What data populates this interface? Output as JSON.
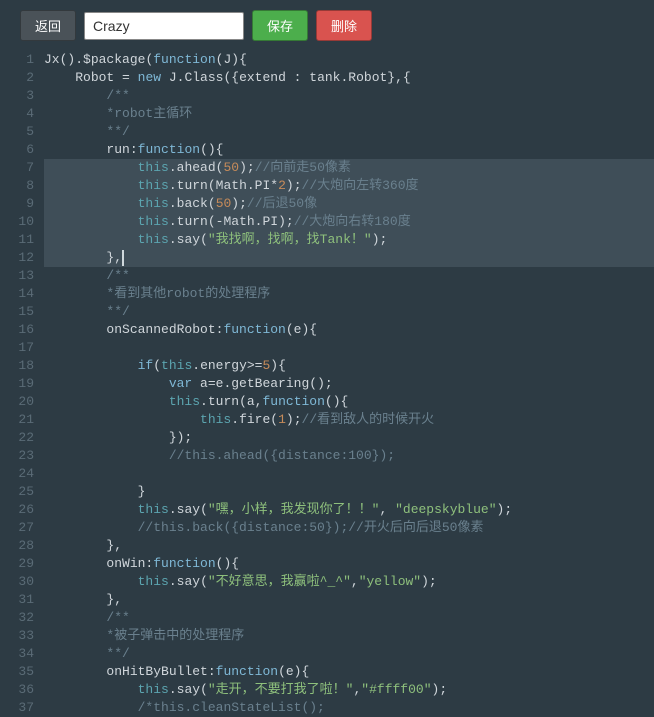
{
  "toolbar": {
    "back_label": "返回",
    "name_value": "Crazy",
    "save_label": "保存",
    "delete_label": "删除"
  },
  "editor": {
    "highlight_start": 7,
    "highlight_end": 12,
    "cursor_line": 12,
    "lines": [
      {
        "n": 1,
        "tokens": [
          [
            "p",
            "Jx()."
          ],
          [
            "p",
            "$package"
          ],
          [
            "p",
            "("
          ],
          [
            "k",
            "function"
          ],
          [
            "p",
            "(J){"
          ]
        ]
      },
      {
        "n": 2,
        "indent": 4,
        "tokens": [
          [
            "p",
            "Robot = "
          ],
          [
            "k",
            "new"
          ],
          [
            "p",
            " J."
          ],
          [
            "fn",
            "Class"
          ],
          [
            "p",
            "({extend : tank.Robot},{"
          ]
        ]
      },
      {
        "n": 3,
        "indent": 8,
        "tokens": [
          [
            "c",
            "/**"
          ]
        ]
      },
      {
        "n": 4,
        "indent": 8,
        "tokens": [
          [
            "c",
            "*robot主循环"
          ]
        ]
      },
      {
        "n": 5,
        "indent": 8,
        "tokens": [
          [
            "c",
            "**/"
          ]
        ]
      },
      {
        "n": 6,
        "indent": 8,
        "tokens": [
          [
            "p",
            "run:"
          ],
          [
            "k",
            "function"
          ],
          [
            "p",
            "(){"
          ]
        ]
      },
      {
        "n": 7,
        "indent": 12,
        "tokens": [
          [
            "b",
            "this"
          ],
          [
            "p",
            "."
          ],
          [
            "fn",
            "ahead"
          ],
          [
            "p",
            "("
          ],
          [
            "n",
            "50"
          ],
          [
            "p",
            ");"
          ],
          [
            "c",
            "//向前走50像素"
          ]
        ]
      },
      {
        "n": 8,
        "indent": 12,
        "tokens": [
          [
            "b",
            "this"
          ],
          [
            "p",
            "."
          ],
          [
            "fn",
            "turn"
          ],
          [
            "p",
            "(Math.PI*"
          ],
          [
            "n",
            "2"
          ],
          [
            "p",
            ");"
          ],
          [
            "c",
            "//大炮向左转360度"
          ]
        ]
      },
      {
        "n": 9,
        "indent": 12,
        "tokens": [
          [
            "b",
            "this"
          ],
          [
            "p",
            "."
          ],
          [
            "fn",
            "back"
          ],
          [
            "p",
            "("
          ],
          [
            "n",
            "50"
          ],
          [
            "p",
            ");"
          ],
          [
            "c",
            "//后退50像"
          ]
        ]
      },
      {
        "n": 10,
        "indent": 12,
        "tokens": [
          [
            "b",
            "this"
          ],
          [
            "p",
            "."
          ],
          [
            "fn",
            "turn"
          ],
          [
            "p",
            "(-Math.PI);"
          ],
          [
            "c",
            "//大炮向右转180度"
          ]
        ]
      },
      {
        "n": 11,
        "indent": 12,
        "tokens": [
          [
            "b",
            "this"
          ],
          [
            "p",
            "."
          ],
          [
            "fn",
            "say"
          ],
          [
            "p",
            "("
          ],
          [
            "s",
            "\"我找啊，找啊，找Tank！\""
          ],
          [
            "p",
            ");"
          ]
        ]
      },
      {
        "n": 12,
        "indent": 8,
        "tokens": [
          [
            "p",
            "},"
          ]
        ]
      },
      {
        "n": 13,
        "indent": 8,
        "tokens": [
          [
            "c",
            "/**"
          ]
        ]
      },
      {
        "n": 14,
        "indent": 8,
        "tokens": [
          [
            "c",
            "*看到其他robot的处理程序"
          ]
        ]
      },
      {
        "n": 15,
        "indent": 8,
        "tokens": [
          [
            "c",
            "**/"
          ]
        ]
      },
      {
        "n": 16,
        "indent": 8,
        "tokens": [
          [
            "p",
            "onScannedRobot:"
          ],
          [
            "k",
            "function"
          ],
          [
            "p",
            "(e){"
          ]
        ]
      },
      {
        "n": 17,
        "indent": 0,
        "tokens": []
      },
      {
        "n": 18,
        "indent": 12,
        "tokens": [
          [
            "k",
            "if"
          ],
          [
            "p",
            "("
          ],
          [
            "b",
            "this"
          ],
          [
            "p",
            ".energy>="
          ],
          [
            "n",
            "5"
          ],
          [
            "p",
            "){"
          ]
        ]
      },
      {
        "n": 19,
        "indent": 16,
        "tokens": [
          [
            "k",
            "var"
          ],
          [
            "p",
            " a=e."
          ],
          [
            "fn",
            "getBearing"
          ],
          [
            "p",
            "();"
          ]
        ]
      },
      {
        "n": 20,
        "indent": 16,
        "tokens": [
          [
            "b",
            "this"
          ],
          [
            "p",
            "."
          ],
          [
            "fn",
            "turn"
          ],
          [
            "p",
            "(a,"
          ],
          [
            "k",
            "function"
          ],
          [
            "p",
            "(){"
          ]
        ]
      },
      {
        "n": 21,
        "indent": 20,
        "tokens": [
          [
            "b",
            "this"
          ],
          [
            "p",
            "."
          ],
          [
            "fn",
            "fire"
          ],
          [
            "p",
            "("
          ],
          [
            "n",
            "1"
          ],
          [
            "p",
            ");"
          ],
          [
            "c",
            "//看到敌人的时候开火"
          ]
        ]
      },
      {
        "n": 22,
        "indent": 16,
        "tokens": [
          [
            "p",
            "});"
          ]
        ]
      },
      {
        "n": 23,
        "indent": 16,
        "tokens": [
          [
            "c",
            "//this.ahead({distance:100});"
          ]
        ]
      },
      {
        "n": 24,
        "indent": 0,
        "tokens": []
      },
      {
        "n": 25,
        "indent": 12,
        "tokens": [
          [
            "p",
            "}"
          ]
        ]
      },
      {
        "n": 26,
        "indent": 12,
        "tokens": [
          [
            "b",
            "this"
          ],
          [
            "p",
            "."
          ],
          [
            "fn",
            "say"
          ],
          [
            "p",
            "("
          ],
          [
            "s",
            "\"嘿，小样，我发现你了！！\""
          ],
          [
            "p",
            ", "
          ],
          [
            "s",
            "\"deepskyblue\""
          ],
          [
            "p",
            ");"
          ]
        ]
      },
      {
        "n": 27,
        "indent": 12,
        "tokens": [
          [
            "c",
            "//this.back({distance:50});//开火后向后退50像素"
          ]
        ]
      },
      {
        "n": 28,
        "indent": 8,
        "tokens": [
          [
            "p",
            "},"
          ]
        ]
      },
      {
        "n": 29,
        "indent": 8,
        "tokens": [
          [
            "p",
            "onWin:"
          ],
          [
            "k",
            "function"
          ],
          [
            "p",
            "(){"
          ]
        ]
      },
      {
        "n": 30,
        "indent": 12,
        "tokens": [
          [
            "b",
            "this"
          ],
          [
            "p",
            "."
          ],
          [
            "fn",
            "say"
          ],
          [
            "p",
            "("
          ],
          [
            "s",
            "\"不好意思，我赢啦^_^\""
          ],
          [
            "p",
            ","
          ],
          [
            "s",
            "\"yellow\""
          ],
          [
            "p",
            ");"
          ]
        ]
      },
      {
        "n": 31,
        "indent": 8,
        "tokens": [
          [
            "p",
            "},"
          ]
        ]
      },
      {
        "n": 32,
        "indent": 8,
        "tokens": [
          [
            "c",
            "/**"
          ]
        ]
      },
      {
        "n": 33,
        "indent": 8,
        "tokens": [
          [
            "c",
            "*被子弹击中的处理程序"
          ]
        ]
      },
      {
        "n": 34,
        "indent": 8,
        "tokens": [
          [
            "c",
            "**/"
          ]
        ]
      },
      {
        "n": 35,
        "indent": 8,
        "tokens": [
          [
            "p",
            "onHitByBullet:"
          ],
          [
            "k",
            "function"
          ],
          [
            "p",
            "(e){"
          ]
        ]
      },
      {
        "n": 36,
        "indent": 12,
        "tokens": [
          [
            "b",
            "this"
          ],
          [
            "p",
            "."
          ],
          [
            "fn",
            "say"
          ],
          [
            "p",
            "("
          ],
          [
            "s",
            "\"走开，不要打我了啦！\""
          ],
          [
            "p",
            ","
          ],
          [
            "s",
            "\"#ffff00\""
          ],
          [
            "p",
            ");"
          ]
        ]
      },
      {
        "n": 37,
        "indent": 12,
        "tokens": [
          [
            "c",
            "/*this.cleanStateList();"
          ]
        ]
      }
    ]
  }
}
